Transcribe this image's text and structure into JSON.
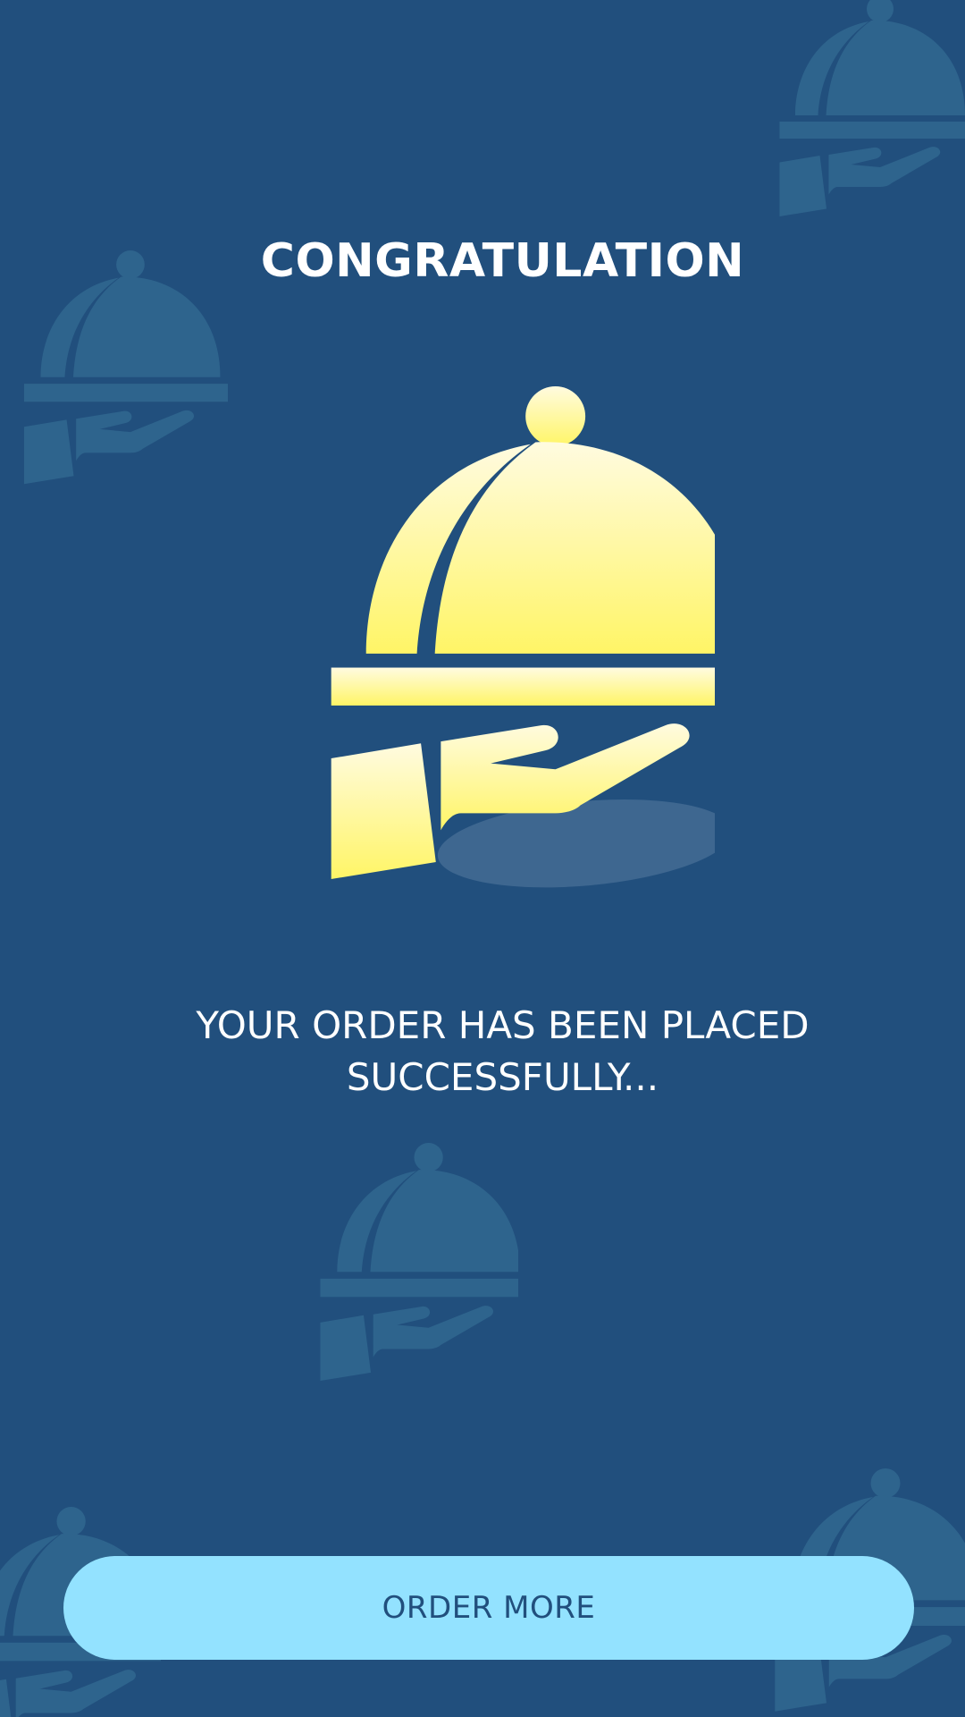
{
  "screen": {
    "title": "CONGRATULATION",
    "message_line1": "YOUR ORDER HAS BEEN  PLACED",
    "message_line2": "SUCCESSFULLY...",
    "order_more_label": "ORDER MORE"
  },
  "icons": {
    "hero": "food-serving-cloche-icon",
    "background": "food-serving-cloche-icon"
  },
  "colors": {
    "background": "#214f7d",
    "pattern": "#2e648d",
    "hero_top": "#fffbe0",
    "hero_bottom": "#fff566",
    "shadow": "#3e6790",
    "button": "#93e2ff",
    "button_text": "#214f7d",
    "text": "#ffffff"
  }
}
